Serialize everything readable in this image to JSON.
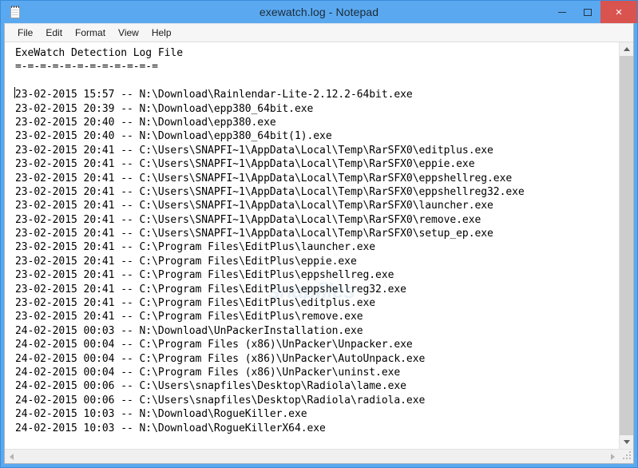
{
  "window": {
    "title": "exewatch.log - Notepad",
    "icon": "notepad-icon",
    "accent_color": "#5aa9f0",
    "close_color": "#d9534f",
    "controls": {
      "minimize": "–",
      "maximize": "□",
      "close": "×"
    }
  },
  "menubar": {
    "items": [
      {
        "label": "File"
      },
      {
        "label": "Edit"
      },
      {
        "label": "Format"
      },
      {
        "label": "View"
      },
      {
        "label": "Help"
      }
    ]
  },
  "watermark": {
    "text": "snapfiles"
  },
  "document": {
    "filename": "exewatch.log",
    "lines": [
      "ExeWatch Detection Log File",
      "=-=-=-=-=-=-=-=-=-=-=-=",
      "",
      "23-02-2015 15:57 -- N:\\Download\\Rainlendar-Lite-2.12.2-64bit.exe",
      "23-02-2015 20:39 -- N:\\Download\\epp380_64bit.exe",
      "23-02-2015 20:40 -- N:\\Download\\epp380.exe",
      "23-02-2015 20:40 -- N:\\Download\\epp380_64bit(1).exe",
      "23-02-2015 20:41 -- C:\\Users\\SNAPFI~1\\AppData\\Local\\Temp\\RarSFX0\\editplus.exe",
      "23-02-2015 20:41 -- C:\\Users\\SNAPFI~1\\AppData\\Local\\Temp\\RarSFX0\\eppie.exe",
      "23-02-2015 20:41 -- C:\\Users\\SNAPFI~1\\AppData\\Local\\Temp\\RarSFX0\\eppshellreg.exe",
      "23-02-2015 20:41 -- C:\\Users\\SNAPFI~1\\AppData\\Local\\Temp\\RarSFX0\\eppshellreg32.exe",
      "23-02-2015 20:41 -- C:\\Users\\SNAPFI~1\\AppData\\Local\\Temp\\RarSFX0\\launcher.exe",
      "23-02-2015 20:41 -- C:\\Users\\SNAPFI~1\\AppData\\Local\\Temp\\RarSFX0\\remove.exe",
      "23-02-2015 20:41 -- C:\\Users\\SNAPFI~1\\AppData\\Local\\Temp\\RarSFX0\\setup_ep.exe",
      "23-02-2015 20:41 -- C:\\Program Files\\EditPlus\\launcher.exe",
      "23-02-2015 20:41 -- C:\\Program Files\\EditPlus\\eppie.exe",
      "23-02-2015 20:41 -- C:\\Program Files\\EditPlus\\eppshellreg.exe",
      "23-02-2015 20:41 -- C:\\Program Files\\EditPlus\\eppshellreg32.exe",
      "23-02-2015 20:41 -- C:\\Program Files\\EditPlus\\editplus.exe",
      "23-02-2015 20:41 -- C:\\Program Files\\EditPlus\\remove.exe",
      "24-02-2015 00:03 -- N:\\Download\\UnPackerInstallation.exe",
      "24-02-2015 00:04 -- C:\\Program Files (x86)\\UnPacker\\Unpacker.exe",
      "24-02-2015 00:04 -- C:\\Program Files (x86)\\UnPacker\\AutoUnpack.exe",
      "24-02-2015 00:04 -- C:\\Program Files (x86)\\UnPacker\\uninst.exe",
      "24-02-2015 00:06 -- C:\\Users\\snapfiles\\Desktop\\Radiola\\lame.exe",
      "24-02-2015 00:06 -- C:\\Users\\snapfiles\\Desktop\\Radiola\\radiola.exe",
      "24-02-2015 10:03 -- N:\\Download\\RogueKiller.exe",
      "24-02-2015 10:03 -- N:\\Download\\RogueKillerX64.exe"
    ]
  },
  "scrollbars": {
    "vertical": {
      "up_arrow": "▲",
      "down_arrow": "▼",
      "thumb_position": "full"
    },
    "horizontal": {
      "left_arrow": "◀",
      "right_arrow": "▶"
    },
    "resize_grip": "resize-grip"
  }
}
